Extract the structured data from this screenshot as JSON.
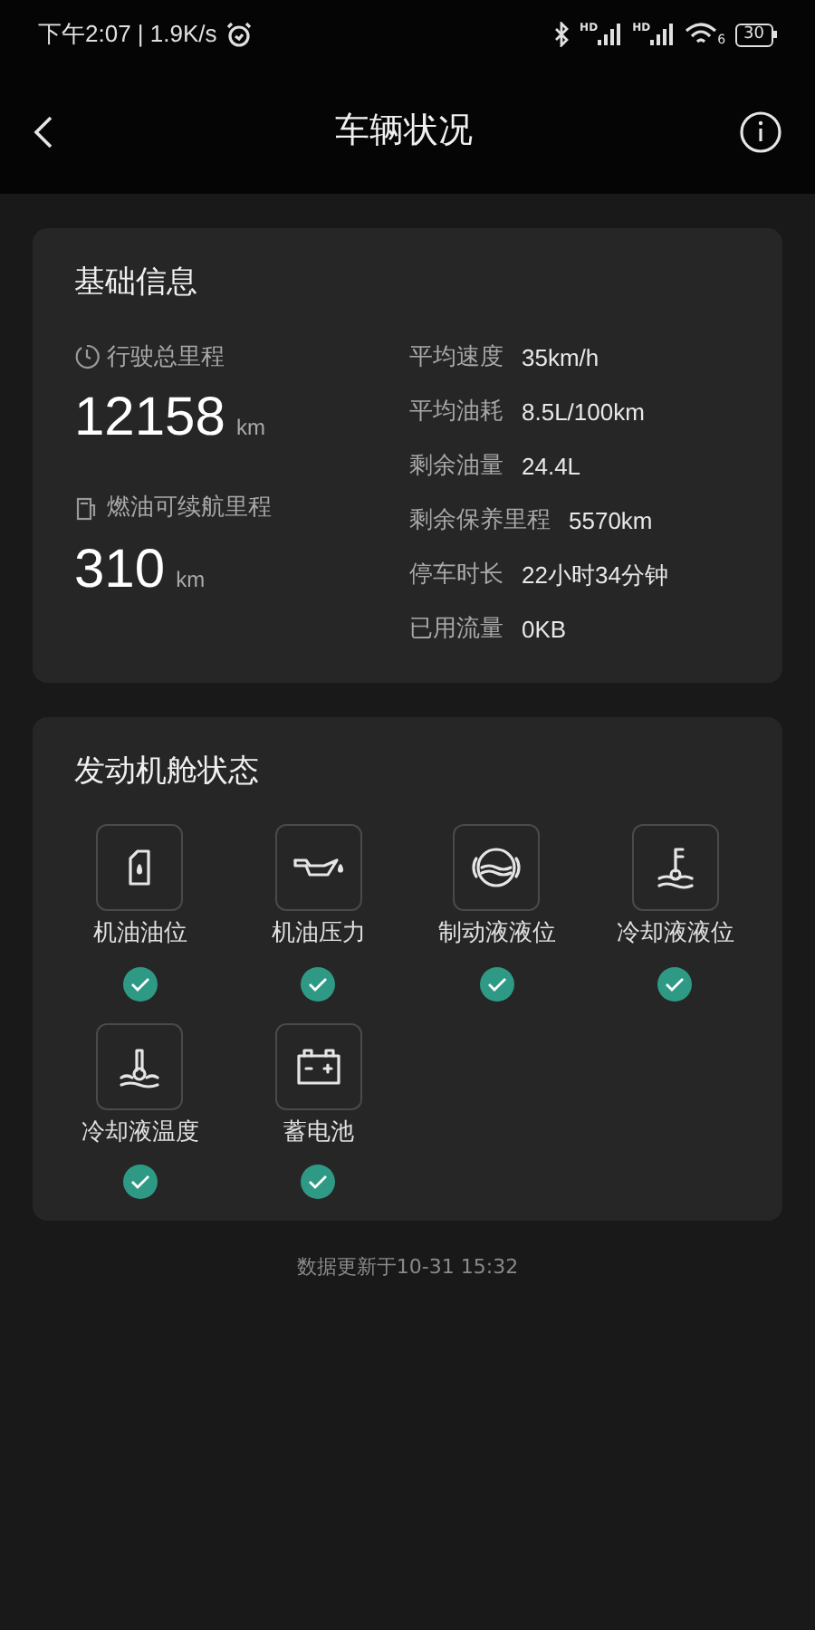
{
  "status_bar": {
    "time_speed": "下午2:07 | 1.9K/s",
    "signal_labels": [
      "HD",
      "HD"
    ],
    "wifi_label": "6",
    "battery": "30"
  },
  "header": {
    "title": "车辆状况"
  },
  "basic_info": {
    "title": "基础信息",
    "main_stats": [
      {
        "kind": "odometer",
        "label": "行驶总里程",
        "value": "12158",
        "unit": "km"
      },
      {
        "kind": "fuel",
        "label": "燃油可续航里程",
        "value": "310",
        "unit": "km"
      }
    ],
    "details": [
      {
        "label": "平均速度",
        "value": "35km/h"
      },
      {
        "label": "平均油耗",
        "value": "8.5L/100km"
      },
      {
        "label": "剩余油量",
        "value": "24.4L"
      },
      {
        "label": "剩余保养里程",
        "value": "5570km"
      },
      {
        "label": "停车时长",
        "value": "22小时34分钟"
      },
      {
        "label": "已用流量",
        "value": "0KB"
      }
    ]
  },
  "engine_status": {
    "title": "发动机舱状态",
    "items": [
      {
        "kind": "oil-can",
        "label": "机油油位",
        "ok": true
      },
      {
        "kind": "oil-pressure",
        "label": "机油压力",
        "ok": true
      },
      {
        "kind": "brake",
        "label": "制动液液位",
        "ok": true
      },
      {
        "kind": "coolant-level",
        "label": "冷却液液位",
        "ok": true
      },
      {
        "kind": "coolant-temp",
        "label": "冷却液温度",
        "ok": true
      },
      {
        "kind": "battery",
        "label": "蓄电池",
        "ok": true
      }
    ]
  },
  "footer": "数据更新于10-31 15:32"
}
